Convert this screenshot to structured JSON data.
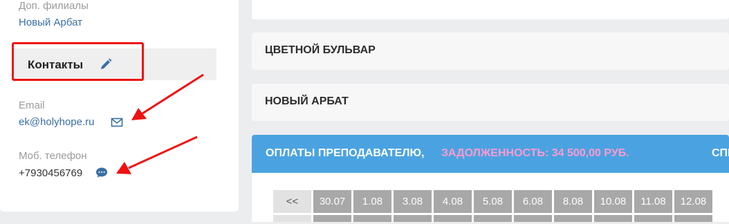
{
  "sidebar": {
    "branches_label": "Доп. филиалы",
    "branch_link": "Новый Арбат",
    "contacts_title": "Контакты",
    "email_label": "Email",
    "email_value": "ek@holyhope.ru",
    "phone_label": "Моб. телефон",
    "phone_value": "+7930456769"
  },
  "branches": [
    {
      "name": "ЦВЕТНОЙ БУЛЬВАР"
    },
    {
      "name": "НОВЫЙ АРБАТ"
    }
  ],
  "payments": {
    "title": "ОПЛАТЫ ПРЕПОДАВАТЕЛЮ,",
    "debt": "ЗАДОЛЖЕННОСТЬ: 34 500,00 РУБ.",
    "cut_link": "СПИ",
    "nav_prev": "<<",
    "dates": [
      "30.07",
      "1.08",
      "3.08",
      "4.08",
      "5.08",
      "6.08",
      "8.08",
      "10.08",
      "11.08",
      "12.08"
    ]
  },
  "colors": {
    "accent_blue": "#4aa3e0",
    "debt_pink": "#ff9ad0",
    "annotation_red": "#ee1111",
    "link_blue": "#3a6ea5"
  }
}
